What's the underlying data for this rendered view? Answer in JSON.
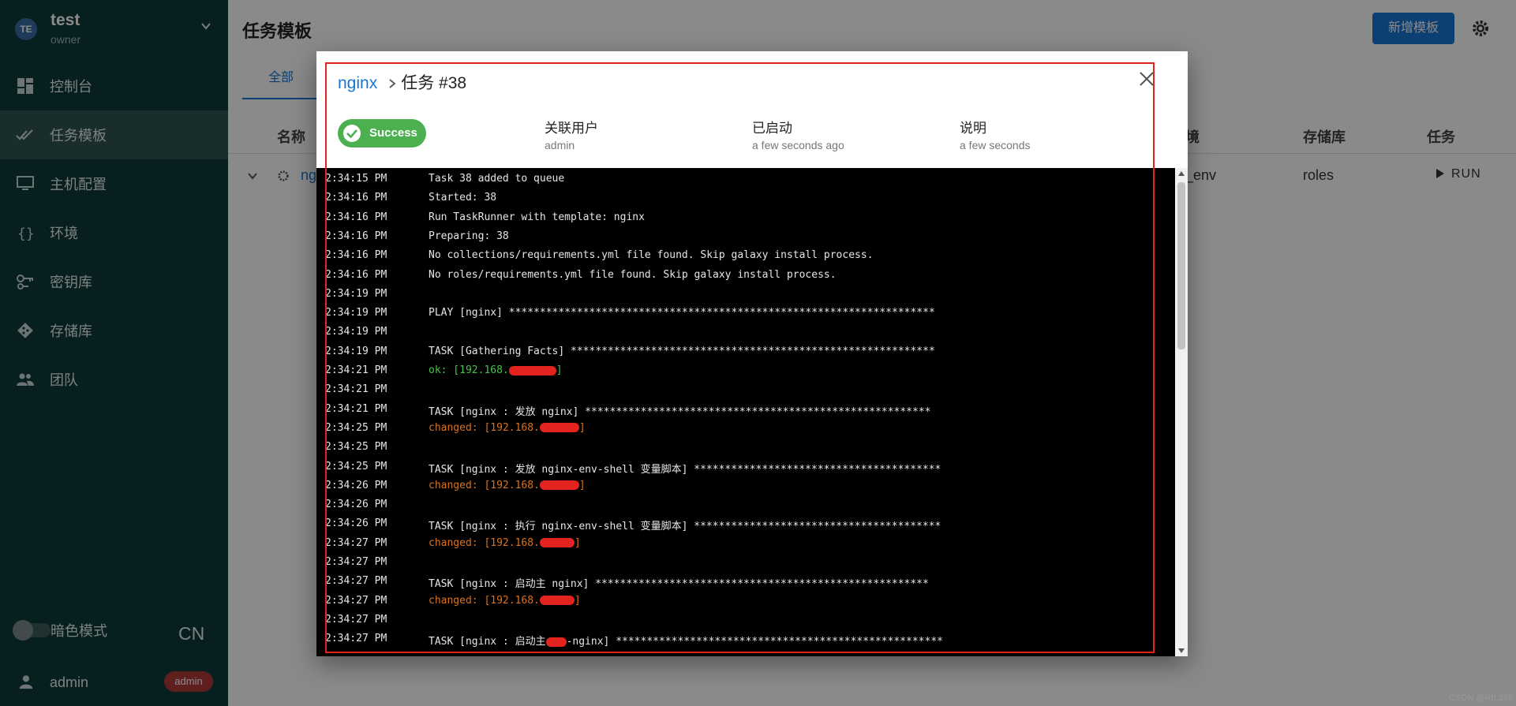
{
  "sidebar": {
    "project": {
      "avatar": "TE",
      "name": "test",
      "role": "owner"
    },
    "items": [
      {
        "label": "控制台",
        "icon": "dashboard-icon"
      },
      {
        "label": "任务模板",
        "icon": "check-all-icon",
        "active": true
      },
      {
        "label": "主机配置",
        "icon": "monitor-icon"
      },
      {
        "label": "环境",
        "icon": "braces-icon"
      },
      {
        "label": "密钥库",
        "icon": "key-icon"
      },
      {
        "label": "存储库",
        "icon": "git-icon"
      },
      {
        "label": "团队",
        "icon": "team-icon"
      }
    ],
    "dark_mode_label": "暗色模式",
    "language": "CN",
    "user": {
      "name": "admin",
      "badge": "admin"
    }
  },
  "main": {
    "title": "任务模板",
    "new_button": "新增模板",
    "tab_all": "全部",
    "columns": {
      "name": "名称",
      "env": "境",
      "repo": "存储库",
      "task": "任务"
    },
    "row": {
      "name": "ng",
      "env": "_env",
      "repo": "roles",
      "run": "RUN"
    }
  },
  "dialog": {
    "project_link": "nginx",
    "task_title": "任务 #38",
    "status": "Success",
    "meta": [
      {
        "key": "关联用户",
        "value": "admin"
      },
      {
        "key": "已启动",
        "value": "a few seconds ago"
      },
      {
        "key": "说明",
        "value": "a few seconds"
      }
    ],
    "log": [
      {
        "t": "2:34:15 PM",
        "m": "Task 38 added to queue"
      },
      {
        "t": "2:34:16 PM",
        "m": "Started: 38"
      },
      {
        "t": "2:34:16 PM",
        "m": "Run TaskRunner with template: nginx"
      },
      {
        "t": "2:34:16 PM",
        "m": "Preparing: 38"
      },
      {
        "t": "2:34:16 PM",
        "m": "No collections/requirements.yml file found. Skip galaxy install process."
      },
      {
        "t": "2:34:16 PM",
        "m": "No roles/requirements.yml file found. Skip galaxy install process."
      },
      {
        "t": "2:34:19 PM",
        "m": ""
      },
      {
        "t": "2:34:19 PM",
        "m": "PLAY [nginx] *********************************************************************"
      },
      {
        "t": "2:34:19 PM",
        "m": ""
      },
      {
        "t": "2:34:19 PM",
        "m": "TASK [Gathering Facts] ***********************************************************"
      },
      {
        "t": "2:34:21 PM",
        "m": "ok: [192.168.",
        "cls": "ok",
        "redact": 60,
        "tail": "]"
      },
      {
        "t": "2:34:21 PM",
        "m": ""
      },
      {
        "t": "2:34:21 PM",
        "m": "TASK [nginx : 发放 nginx] ********************************************************"
      },
      {
        "t": "2:34:25 PM",
        "m": "changed: [192.168.",
        "cls": "chg",
        "redact": 50,
        "tail": "]"
      },
      {
        "t": "2:34:25 PM",
        "m": ""
      },
      {
        "t": "2:34:25 PM",
        "m": "TASK [nginx : 发放 nginx-env-shell 变量脚本] ****************************************"
      },
      {
        "t": "2:34:26 PM",
        "m": "changed: [192.168.",
        "cls": "chg",
        "redact": 50,
        "tail": "]"
      },
      {
        "t": "2:34:26 PM",
        "m": ""
      },
      {
        "t": "2:34:26 PM",
        "m": "TASK [nginx : 执行 nginx-env-shell 变量脚本] ****************************************"
      },
      {
        "t": "2:34:27 PM",
        "m": "changed: [192.168.",
        "cls": "chg",
        "redact": 44,
        "tail": "]"
      },
      {
        "t": "2:34:27 PM",
        "m": ""
      },
      {
        "t": "2:34:27 PM",
        "m": "TASK [nginx : 启动主 nginx] ******************************************************"
      },
      {
        "t": "2:34:27 PM",
        "m": "changed: [192.168.",
        "cls": "chg",
        "redact": 44,
        "tail": "]"
      },
      {
        "t": "2:34:27 PM",
        "m": ""
      },
      {
        "t": "2:34:27 PM",
        "m": "TASK [nginx : 启动主",
        "redact": 26,
        "tail": "-nginx] *****************************************************"
      }
    ]
  },
  "watermark": "CSDN @Rh.355"
}
